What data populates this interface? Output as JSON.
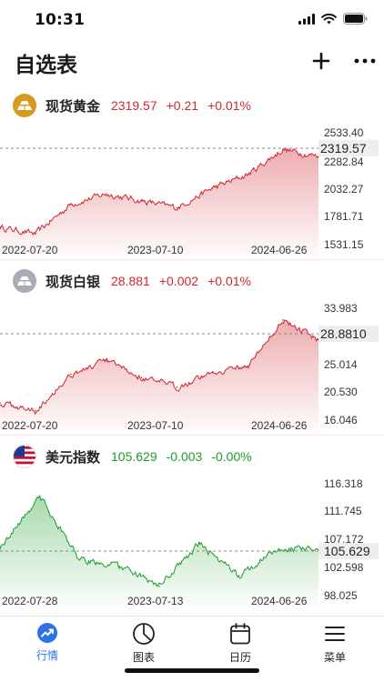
{
  "status": {
    "time": "10:31"
  },
  "header": {
    "title": "自选表",
    "add_icon": "plus-icon",
    "more_icon": "ellipsis-icon"
  },
  "colors": {
    "up": "#d0262e",
    "down": "#1c9c2a",
    "accent": "#2a73e8",
    "gold": "#d69b1e",
    "silver": "#a9acb3"
  },
  "cards": [
    {
      "name": "现货黄金",
      "icon": "gold-bar-icon",
      "price": "2319.57",
      "change": "+0.21",
      "percent": "+0.01%",
      "trend": "up",
      "ylabels": [
        "2533.40",
        "2282.84",
        "2032.27",
        "1781.71",
        "1531.15"
      ],
      "xlabels": [
        "2022-07-20",
        "2023-07-10",
        "2024-06-26"
      ],
      "price_tag": "2319.57"
    },
    {
      "name": "现货白银",
      "icon": "silver-bar-icon",
      "price": "28.881",
      "change": "+0.002",
      "percent": "+0.01%",
      "trend": "up",
      "ylabels": [
        "33.983",
        "25.014",
        "20.530",
        "16.046"
      ],
      "xlabels": [
        "2022-07-20",
        "2023-07-10",
        "2024-06-26"
      ],
      "price_tag": "28.8810"
    },
    {
      "name": "美元指数",
      "icon": "us-flag-icon",
      "price": "105.629",
      "change": "-0.003",
      "percent": "-0.00%",
      "trend": "down",
      "ylabels": [
        "116.318",
        "111.745",
        "107.172",
        "102.598",
        "98.025"
      ],
      "xlabels": [
        "2022-07-28",
        "2023-07-13",
        "2024-06-26"
      ],
      "price_tag": "105.629"
    }
  ],
  "chart_data": [
    {
      "type": "area",
      "title": "现货黄金",
      "x": [
        "2022-07-20",
        "2022-10",
        "2023-01",
        "2023-04",
        "2023-07-10",
        "2023-10",
        "2024-01",
        "2024-03",
        "2024-04",
        "2024-06-26"
      ],
      "values": [
        1700,
        1640,
        1900,
        1990,
        1930,
        1870,
        2040,
        2160,
        2380,
        2319.57
      ],
      "ylim": [
        1531.15,
        2533.4
      ]
    },
    {
      "type": "area",
      "title": "现货白银",
      "x": [
        "2022-07-20",
        "2022-09",
        "2023-01",
        "2023-04",
        "2023-07-10",
        "2023-10",
        "2024-01",
        "2024-03",
        "2024-05",
        "2024-06-26"
      ],
      "values": [
        19.0,
        17.8,
        23.5,
        25.6,
        23.0,
        21.5,
        23.8,
        24.8,
        32.0,
        28.881
      ],
      "ylim": [
        16.046,
        33.983
      ]
    },
    {
      "type": "area",
      "title": "美元指数",
      "x": [
        "2022-07-28",
        "2022-09-27",
        "2022-12",
        "2023-02",
        "2023-07-13",
        "2023-10",
        "2023-12",
        "2024-04",
        "2024-06-26"
      ],
      "values": [
        106.0,
        114.2,
        104.0,
        103.0,
        99.8,
        106.6,
        101.5,
        105.8,
        105.629
      ],
      "ylim": [
        98.025,
        116.318
      ]
    }
  ],
  "tabs": [
    {
      "label": "行情",
      "icon": "trend-icon",
      "active": true
    },
    {
      "label": "图表",
      "icon": "pie-chart-icon",
      "active": false
    },
    {
      "label": "日历",
      "icon": "calendar-icon",
      "active": false
    },
    {
      "label": "菜单",
      "icon": "menu-icon",
      "active": false
    }
  ]
}
